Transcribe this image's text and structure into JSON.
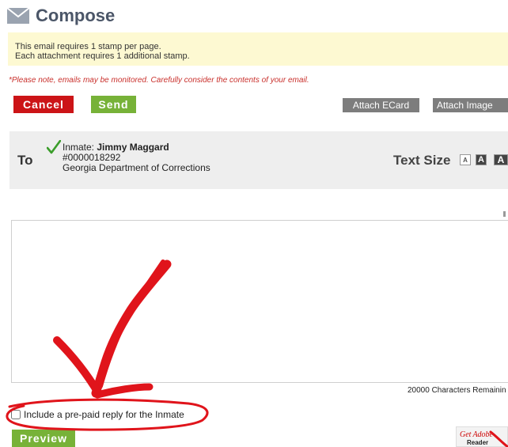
{
  "header": {
    "title": "Compose",
    "icon": "envelope-icon"
  },
  "notice": {
    "line1": "This email requires 1 stamp per page.",
    "line2": "Each attachment requires 1 additional stamp."
  },
  "warning": "*Please note, emails may be monitored. Carefully consider the contents of your email.",
  "toolbar": {
    "cancel_label": "Cancel",
    "send_label": "Send",
    "attach_ecard_label": "Attach ECard",
    "attach_image_label": "Attach Image"
  },
  "recipient": {
    "to_label": "To",
    "inmate_prefix": "Inmate: ",
    "inmate_name": "Jimmy Maggard",
    "inmate_id": "#0000018292",
    "facility": "Georgia Department of Corrections",
    "verified_icon": "checkmark-icon"
  },
  "text_size": {
    "label": "Text Size",
    "small": "A",
    "medium": "A",
    "large": "A"
  },
  "message": {
    "value": "",
    "characters_remaining": "20000 Characters Remainin"
  },
  "reply_option": {
    "label": "Include a pre-paid reply for the Inmate",
    "checked": false
  },
  "preview_label": "Preview",
  "adobe_badge": {
    "get": "Get",
    "adobe": "Adobe",
    "reader": "Reader"
  },
  "colors": {
    "cancel": "#cc1417",
    "send": "#77b238",
    "notice_bg": "#fdf9d2",
    "warning_text": "#c9302c",
    "annotation": "#e0141b"
  }
}
